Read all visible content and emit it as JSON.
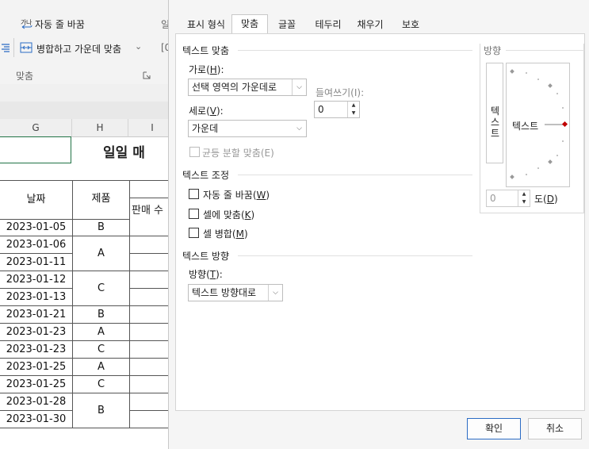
{
  "ribbon": {
    "wrap_text": "자동 줄 바꿈",
    "merge_center": "병합하고 가운데 맞춤",
    "group_label": "맞춤",
    "merge_dropdown_arrow": "⌄",
    "partial_label_1": "일",
    "partial_label_2": "[0"
  },
  "sheet": {
    "col_headers": [
      "G",
      "H",
      "I"
    ],
    "title_partial": "일일 매",
    "header_date": "날짜",
    "header_product": "제품",
    "header_sales_partial": "판매 수",
    "rows": [
      {
        "date": "2023-01-05",
        "product": "B"
      },
      {
        "date": "2023-01-06",
        "product": "A"
      },
      {
        "date": "2023-01-11",
        "product": ""
      },
      {
        "date": "2023-01-12",
        "product": "C"
      },
      {
        "date": "2023-01-13",
        "product": ""
      },
      {
        "date": "2023-01-21",
        "product": "B"
      },
      {
        "date": "2023-01-23",
        "product": "A"
      },
      {
        "date": "2023-01-23",
        "product": "C"
      },
      {
        "date": "2023-01-25",
        "product": "A"
      },
      {
        "date": "2023-01-25",
        "product": "C"
      },
      {
        "date": "2023-01-28",
        "product": "B"
      },
      {
        "date": "2023-01-30",
        "product": ""
      }
    ]
  },
  "dialog": {
    "tabs": [
      "표시 형식",
      "맞춤",
      "글꼴",
      "테두리",
      "채우기",
      "보호"
    ],
    "active_tab": "맞춤",
    "text_align_section": "텍스트 맞춤",
    "horizontal_label": "가로(",
    "horizontal_key": "H",
    "horizontal_value": "선택 영역의 가운데로",
    "indent_label": "들여쓰기(I):",
    "indent_value": "0",
    "vertical_label": "세로(",
    "vertical_key": "V",
    "vertical_value": "가운데",
    "justify_distributed": "균등 분할 맞춤(E)",
    "text_control_section": "텍스트 조정",
    "wrap_text": "자동 줄 바꿈(",
    "wrap_key": "W",
    "shrink_to_fit": "셀에 맞춤(",
    "shrink_key": "K",
    "merge_cells": "셀 병합(",
    "merge_key": "M",
    "rtl_section": "텍스트 방향",
    "direction_label": "방향(",
    "direction_key": "T",
    "direction_value": "텍스트 방향대로",
    "orientation_section": "방향",
    "vertical_text": [
      "텍",
      "스",
      "트"
    ],
    "orientation_text": "텍스트",
    "degrees_value": "0",
    "degrees_label": "도(",
    "degrees_key": "D",
    "ok": "확인",
    "cancel": "취소",
    "close_paren": "):",
    "close_paren_plain": ")"
  },
  "colors": {
    "accent": "#2b6cc4",
    "orientation_marker": "#c00000",
    "selection_green": "#217346"
  }
}
